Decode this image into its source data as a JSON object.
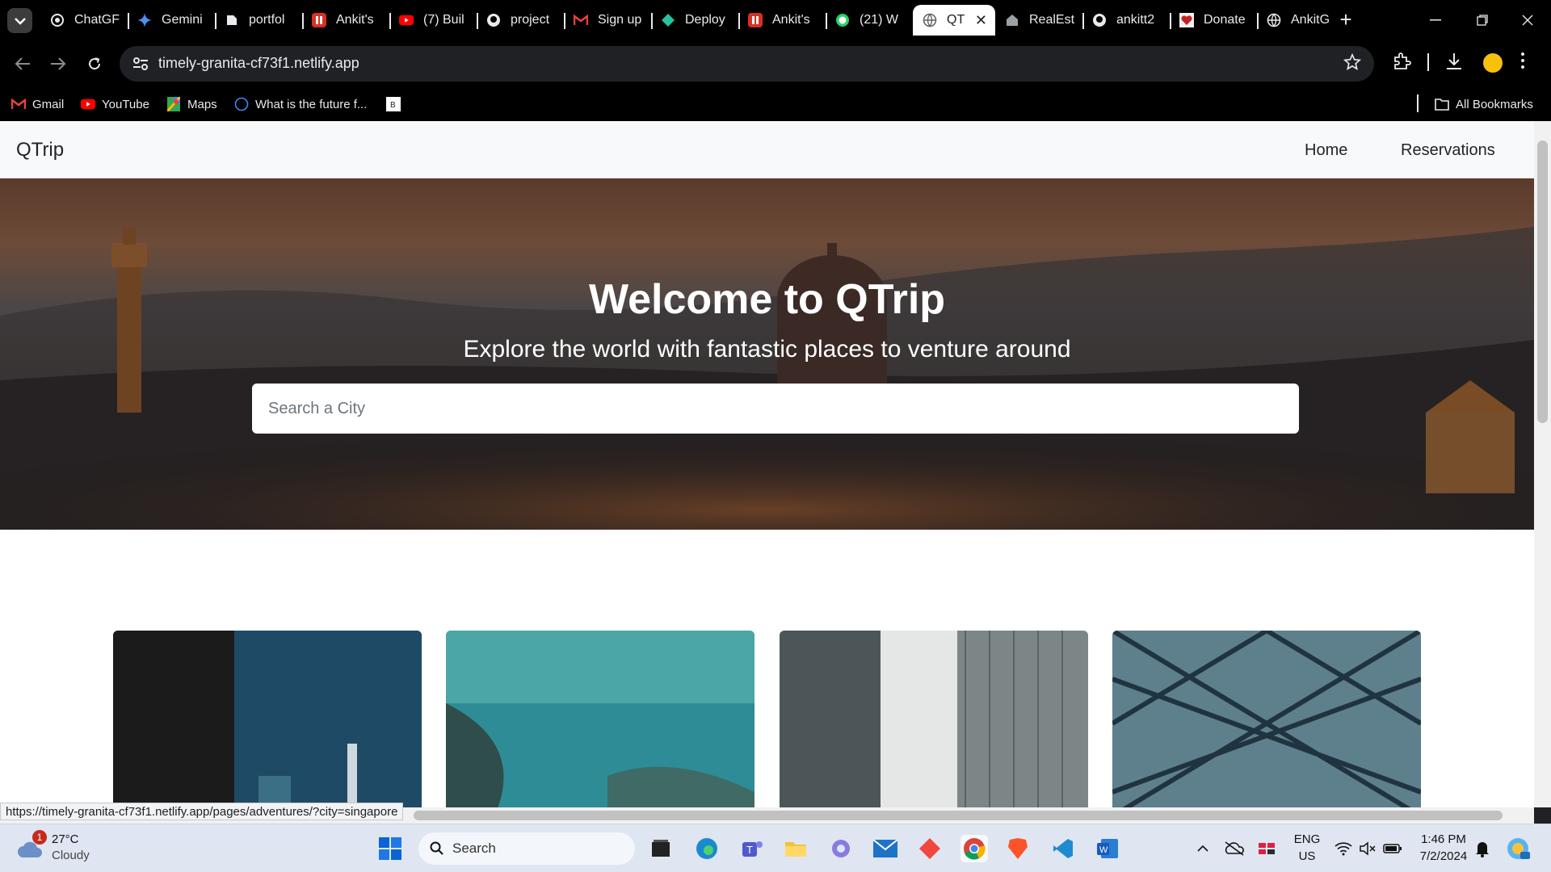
{
  "browser": {
    "tabs": [
      {
        "label": "ChatGF",
        "icon": "openai-icon"
      },
      {
        "label": "Gemini",
        "icon": "gemini-icon"
      },
      {
        "label": "portfol",
        "icon": "page-icon"
      },
      {
        "label": "Ankit's",
        "icon": "red-logo-icon"
      },
      {
        "label": "(7) Buil",
        "icon": "youtube-icon"
      },
      {
        "label": "project",
        "icon": "github-icon"
      },
      {
        "label": "Sign up",
        "icon": "gmail-icon"
      },
      {
        "label": "Deploy",
        "icon": "deploy-icon"
      },
      {
        "label": "Ankit's",
        "icon": "red-logo-icon"
      },
      {
        "label": "(21) W",
        "icon": "whatsapp-icon"
      },
      {
        "label": "QT",
        "icon": "globe-icon",
        "active": true
      },
      {
        "label": "RealEst",
        "icon": "realestate-icon"
      },
      {
        "label": "ankitt2",
        "icon": "github-icon"
      },
      {
        "label": "Donate",
        "icon": "donate-icon"
      },
      {
        "label": "AnkitG",
        "icon": "globe-icon"
      }
    ],
    "url": "timely-granita-cf73f1.netlify.app",
    "bookmarks": [
      {
        "label": "Gmail",
        "icon": "gmail-icon"
      },
      {
        "label": "YouTube",
        "icon": "youtube-icon"
      },
      {
        "label": "Maps",
        "icon": "maps-icon"
      },
      {
        "label": "What is the future f...",
        "icon": "circle-icon"
      },
      {
        "label": "",
        "icon": "b-icon"
      }
    ],
    "all_bookmarks": "All Bookmarks",
    "status_url": "https://timely-granita-cf73f1.netlify.app/pages/adventures/?city=singapore"
  },
  "site": {
    "brand": "QTrip",
    "nav": {
      "home": "Home",
      "reservations": "Reservations"
    },
    "hero": {
      "title": "Welcome to QTrip",
      "subtitle": "Explore the world with fantastic places to venture around",
      "search_placeholder": "Search a City"
    }
  },
  "taskbar": {
    "weather": {
      "temp": "27°C",
      "desc": "Cloudy",
      "badge": "1"
    },
    "search_label": "Search",
    "lang": {
      "line1": "ENG",
      "line2": "US"
    },
    "time": "1:46 PM",
    "date": "7/2/2024"
  }
}
